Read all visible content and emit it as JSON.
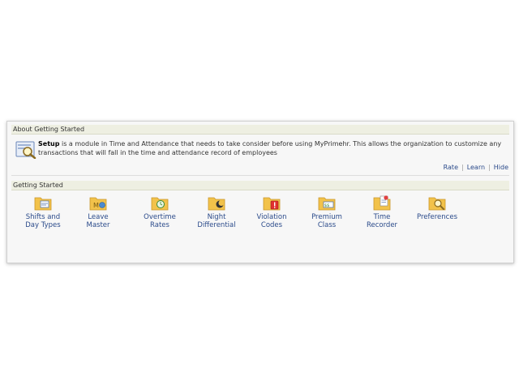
{
  "about": {
    "header": "About Getting Started",
    "setup_word": "Setup",
    "description": " is a module in Time and Attendance that needs to take consider before using MyPrimehr. This allows the organization to customize any transactions that will fall in the time and attendance record of employees",
    "links": {
      "rate": "Rate",
      "learn": "Learn",
      "hide": "Hide"
    }
  },
  "getting_started": {
    "header": "Getting Started",
    "items": [
      {
        "label": "Shifts and\nDay Types",
        "icon": "shifts-folder-icon"
      },
      {
        "label": "Leave\nMaster",
        "icon": "leave-folder-icon"
      },
      {
        "label": "Overtime\nRates",
        "icon": "overtime-folder-icon"
      },
      {
        "label": "Night\nDifferential",
        "icon": "night-folder-icon"
      },
      {
        "label": "Violation\nCodes",
        "icon": "violation-folder-icon"
      },
      {
        "label": "Premium\nClass",
        "icon": "premium-folder-icon"
      },
      {
        "label": "Time\nRecorder",
        "icon": "time-recorder-folder-icon"
      },
      {
        "label": "Preferences",
        "icon": "preferences-folder-icon"
      }
    ]
  },
  "colors": {
    "link": "#2a4a8a",
    "header_bg": "#eeefe2",
    "folder": "#f2c24a"
  }
}
